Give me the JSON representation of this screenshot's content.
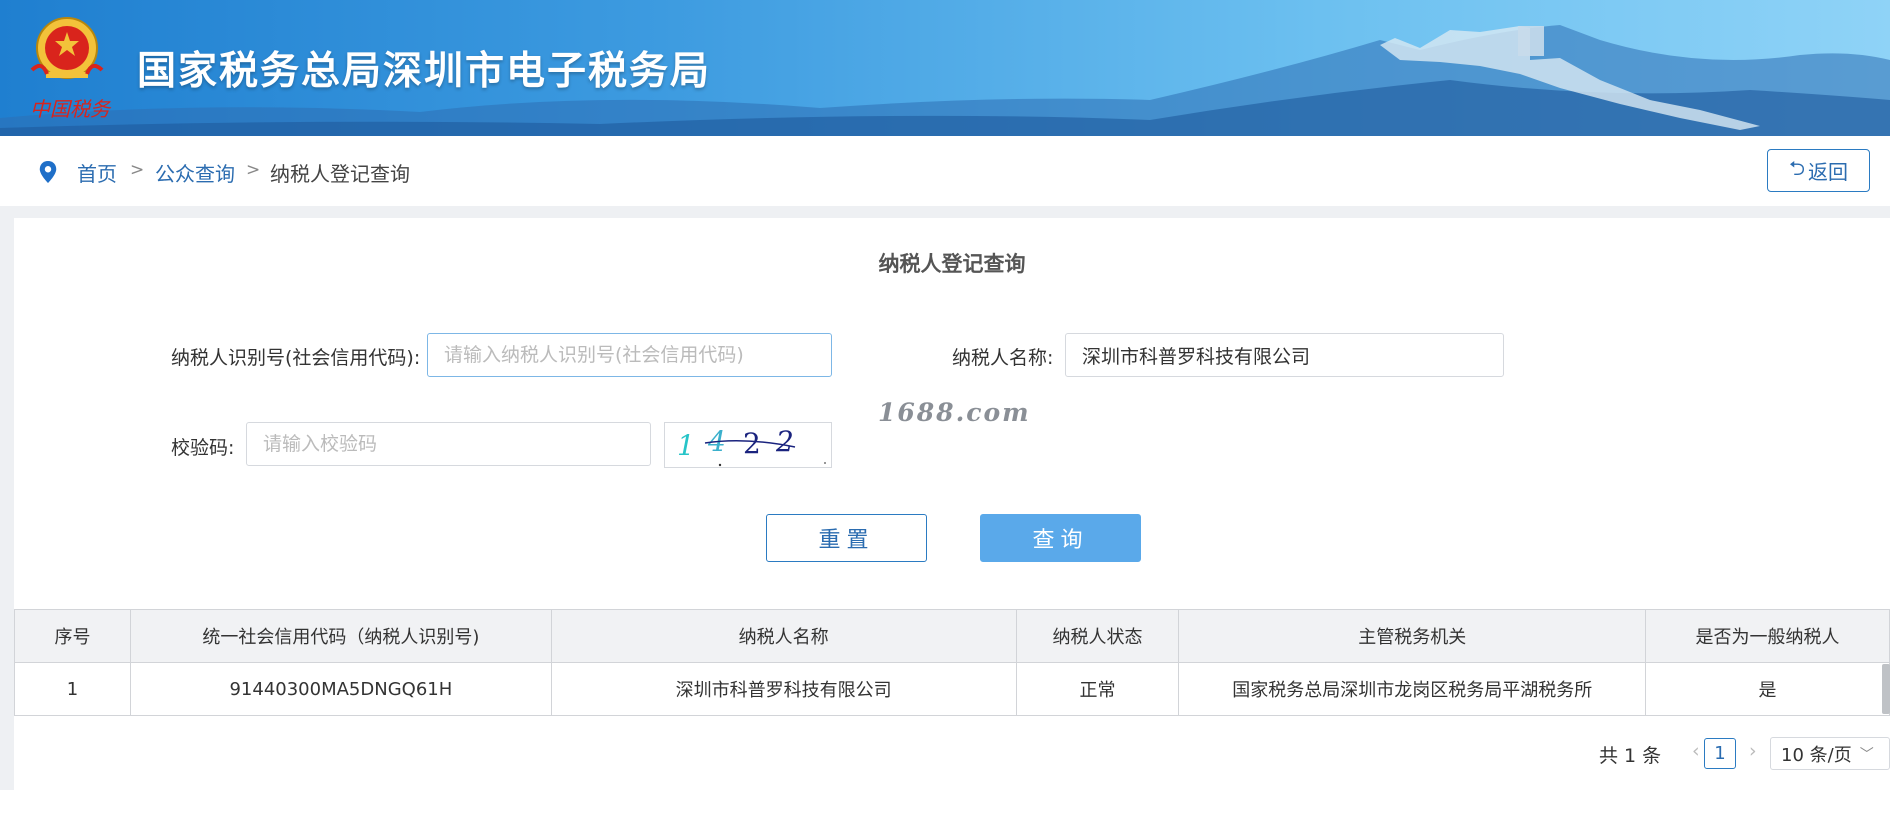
{
  "header": {
    "title": "国家税务总局深圳市电子税务局",
    "emblem_caption": "中国税务"
  },
  "breadcrumb": {
    "items": [
      {
        "label": "首页"
      },
      {
        "label": "公众查询"
      },
      {
        "label": "纳税人登记查询"
      }
    ],
    "separator": ">"
  },
  "back_button": {
    "icon": "undo-icon",
    "label": "返回"
  },
  "form": {
    "title": "纳税人登记查询",
    "taxpayer_id": {
      "label": "纳税人识别号(社会信用代码):",
      "value": "",
      "placeholder": "请输入纳税人识别号(社会信用代码)"
    },
    "taxpayer_name": {
      "label": "纳税人名称:",
      "value": "深圳市科普罗科技有限公司",
      "placeholder": ""
    },
    "captcha": {
      "label": "校验码:",
      "value": "",
      "placeholder": "请输入校验码",
      "image_text": "1422"
    },
    "reset_label": "重置",
    "query_label": "查询"
  },
  "watermark": "1688.com",
  "table": {
    "columns": [
      "序号",
      "统一社会信用代码（纳税人识别号)",
      "纳税人名称",
      "纳税人状态",
      "主管税务机关",
      "是否为一般纳税人"
    ],
    "rows": [
      [
        "1",
        "91440300MA5DNGQ61H",
        "深圳市科普罗科技有限公司",
        "正常",
        "国家税务总局深圳市龙岗区税务局平湖税务所",
        "是"
      ]
    ]
  },
  "pagination": {
    "total_text": "共 1 条",
    "current_page": "1",
    "page_size": "10 条/页"
  },
  "colors": {
    "accent": "#2b6cb0",
    "query_button": "#5aa9ea",
    "banner": "#3d9be0"
  }
}
